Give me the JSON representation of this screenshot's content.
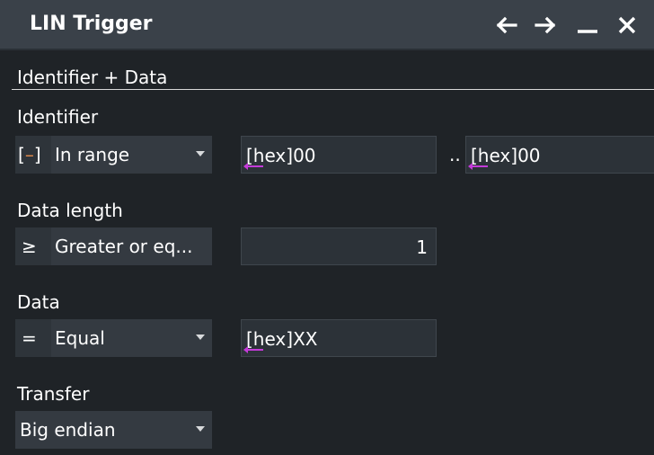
{
  "window": {
    "title": "LIN Trigger",
    "buttons": {
      "back": "back-arrow-icon",
      "forward": "forward-arrow-icon",
      "minimize": "minimize-icon",
      "close": "close-icon"
    }
  },
  "section": {
    "header": "Identifier + Data"
  },
  "identifier": {
    "label": "Identifier",
    "condition": {
      "symbol": "[–]",
      "value": "In range"
    },
    "min": "[hex]00",
    "separator": "..",
    "max": "[hex]00"
  },
  "data_length": {
    "label": "Data length",
    "condition": {
      "symbol": "≥",
      "value": "Greater or eq..."
    },
    "value": "1"
  },
  "data": {
    "label": "Data",
    "condition": {
      "symbol": "=",
      "value": "Equal"
    },
    "value": "[hex]XX"
  },
  "transfer": {
    "label": "Transfer",
    "value": "Big endian"
  },
  "colors": {
    "background": "#1f2327",
    "titlebar": "#3a4149",
    "control": "#343a41",
    "field": "#2c3238",
    "hex_marker": "#c43bd9"
  }
}
